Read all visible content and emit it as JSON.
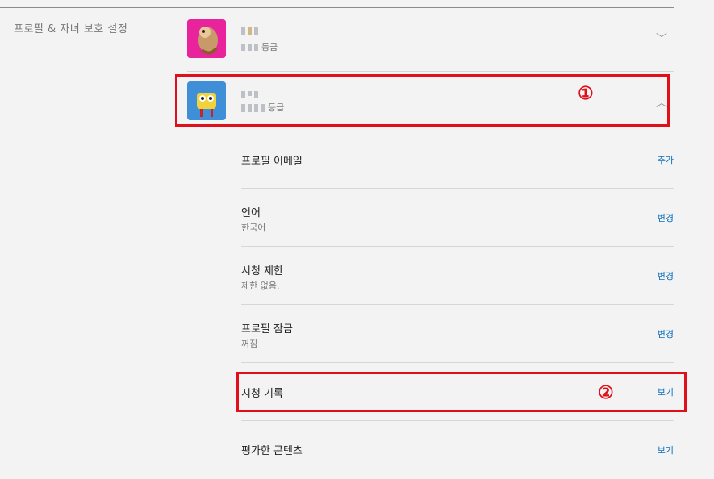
{
  "section_title": "프로필 & 자녀 보호 설정",
  "profiles": [
    {
      "name_masked": true,
      "rating_suffix": "등급",
      "expanded": false,
      "chevron": "chevron-down-icon"
    },
    {
      "name_masked": true,
      "rating_suffix": "등급",
      "expanded": true,
      "chevron": "chevron-up-icon"
    }
  ],
  "settings": [
    {
      "label": "프로필 이메일",
      "value": "",
      "action": "추가"
    },
    {
      "label": "언어",
      "value": "한국어",
      "action": "변경"
    },
    {
      "label": "시청 제한",
      "value": "제한 없음.",
      "action": "변경"
    },
    {
      "label": "프로필 잠금",
      "value": "꺼짐",
      "action": "변경"
    },
    {
      "label": "시청 기록",
      "value": "",
      "action": "보기"
    },
    {
      "label": "평가한 콘텐츠",
      "value": "",
      "action": "보기"
    }
  ],
  "annotations": {
    "one": "①",
    "two": "②"
  },
  "colors": {
    "highlight": "#e0101a",
    "link": "#0a6ebd",
    "background": "#f3f3f3"
  }
}
